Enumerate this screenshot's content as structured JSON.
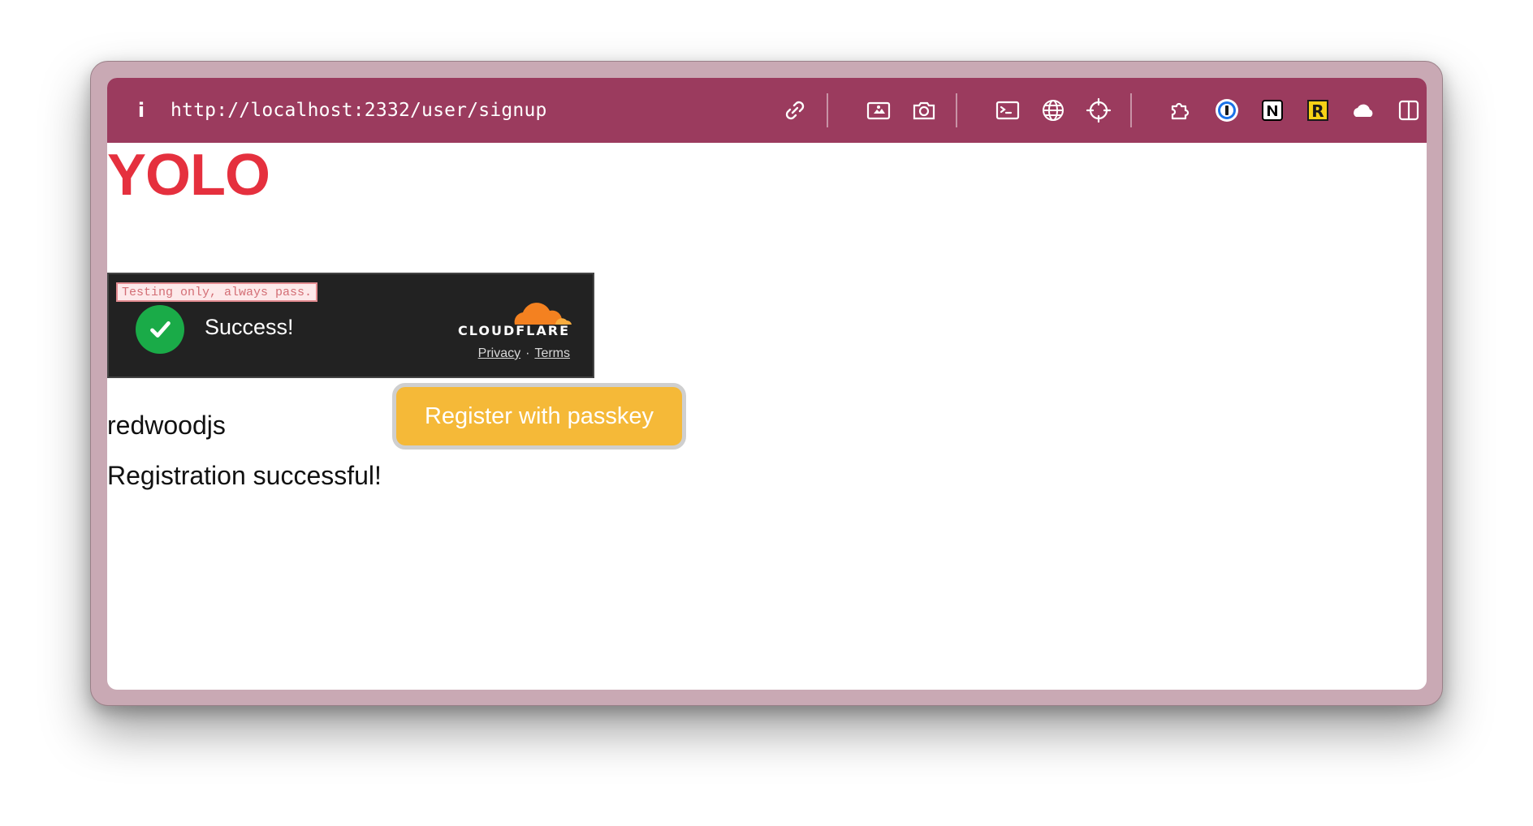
{
  "browser": {
    "url": "http://localhost:2332/user/signup",
    "toolbar_color": "#9b3b5e",
    "icons": [
      "info-icon",
      "link-icon",
      "screenshot-area-icon",
      "camera-icon",
      "terminal-icon",
      "globe-icon",
      "crosshair-icon",
      "extensions-icon",
      "1password-icon",
      "notion-icon",
      "r-extension-icon",
      "cloud-icon",
      "sidebar-toggle-icon"
    ]
  },
  "page": {
    "heading": "YOLO",
    "heading_color": "#e5303e"
  },
  "turnstile": {
    "test_notice": "Testing only, always pass.",
    "status": "Success!",
    "brand": "CLOUDFLARE",
    "privacy_link": "Privacy",
    "separator": "·",
    "terms_link": "Terms",
    "brand_color": "#f48120",
    "check_color": "#1aab48"
  },
  "signup": {
    "username": "redwoodjs",
    "button_label": "Register with passkey",
    "button_color": "#f5b938",
    "status_message": "Registration successful!"
  }
}
